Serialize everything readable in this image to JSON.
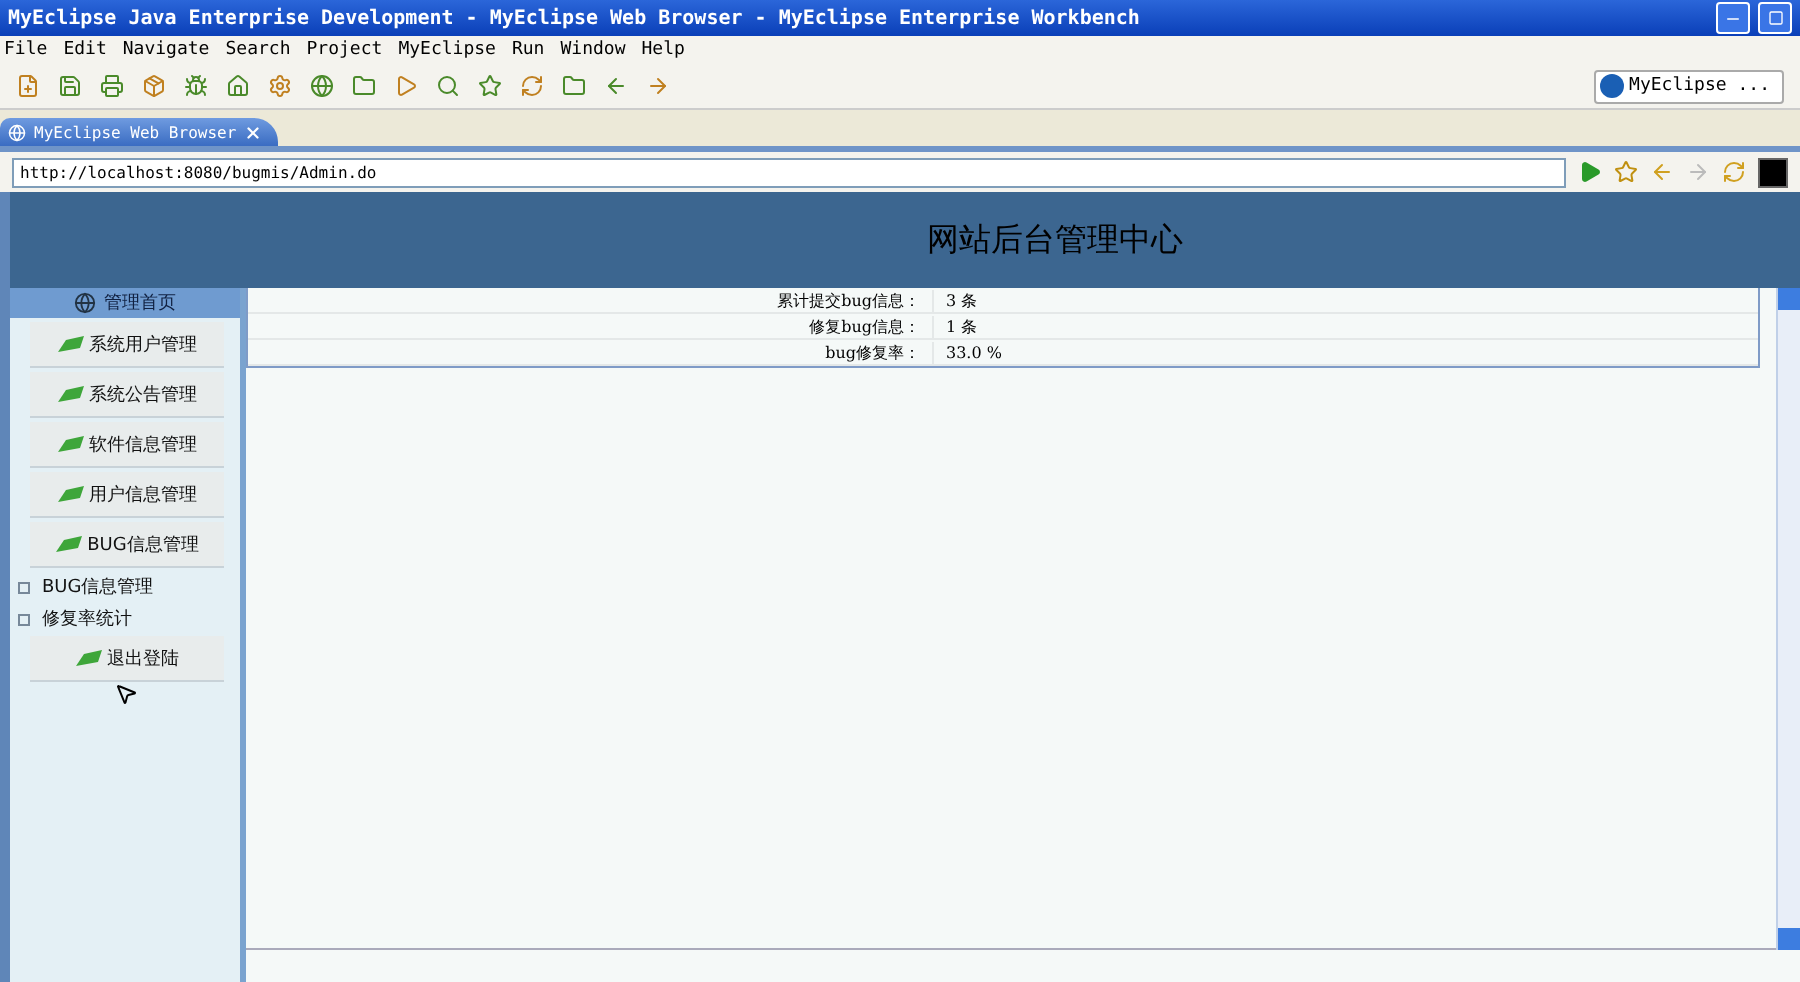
{
  "window": {
    "title": "MyEclipse Java Enterprise Development - MyEclipse Web Browser - MyEclipse Enterprise Workbench"
  },
  "menu": [
    "File",
    "Edit",
    "Navigate",
    "Search",
    "Project",
    "MyEclipse",
    "Run",
    "Window",
    "Help"
  ],
  "perspective": {
    "label": "MyEclipse ..."
  },
  "tab": {
    "label": "MyEclipse Web Browser",
    "selected": true
  },
  "address": {
    "value": "http://localhost:8080/bugmis/Admin.do"
  },
  "page": {
    "header_title": "网站后台管理中心",
    "sidebar": {
      "home_label": "管理首页",
      "items": [
        {
          "kind": "button",
          "label": "系统用户管理"
        },
        {
          "kind": "button",
          "label": "系统公告管理"
        },
        {
          "kind": "button",
          "label": "软件信息管理"
        },
        {
          "kind": "button",
          "label": "用户信息管理"
        },
        {
          "kind": "button",
          "label": "BUG信息管理"
        },
        {
          "kind": "link",
          "label": "BUG信息管理"
        },
        {
          "kind": "link",
          "label": "修复率统计"
        },
        {
          "kind": "button",
          "label": "退出登陆"
        }
      ]
    },
    "stats": [
      {
        "label": "累计提交bug信息：",
        "value": "3 条"
      },
      {
        "label": "修复bug信息：",
        "value": "1 条"
      },
      {
        "label": "bug修复率：",
        "value": "33.0 %"
      }
    ]
  }
}
